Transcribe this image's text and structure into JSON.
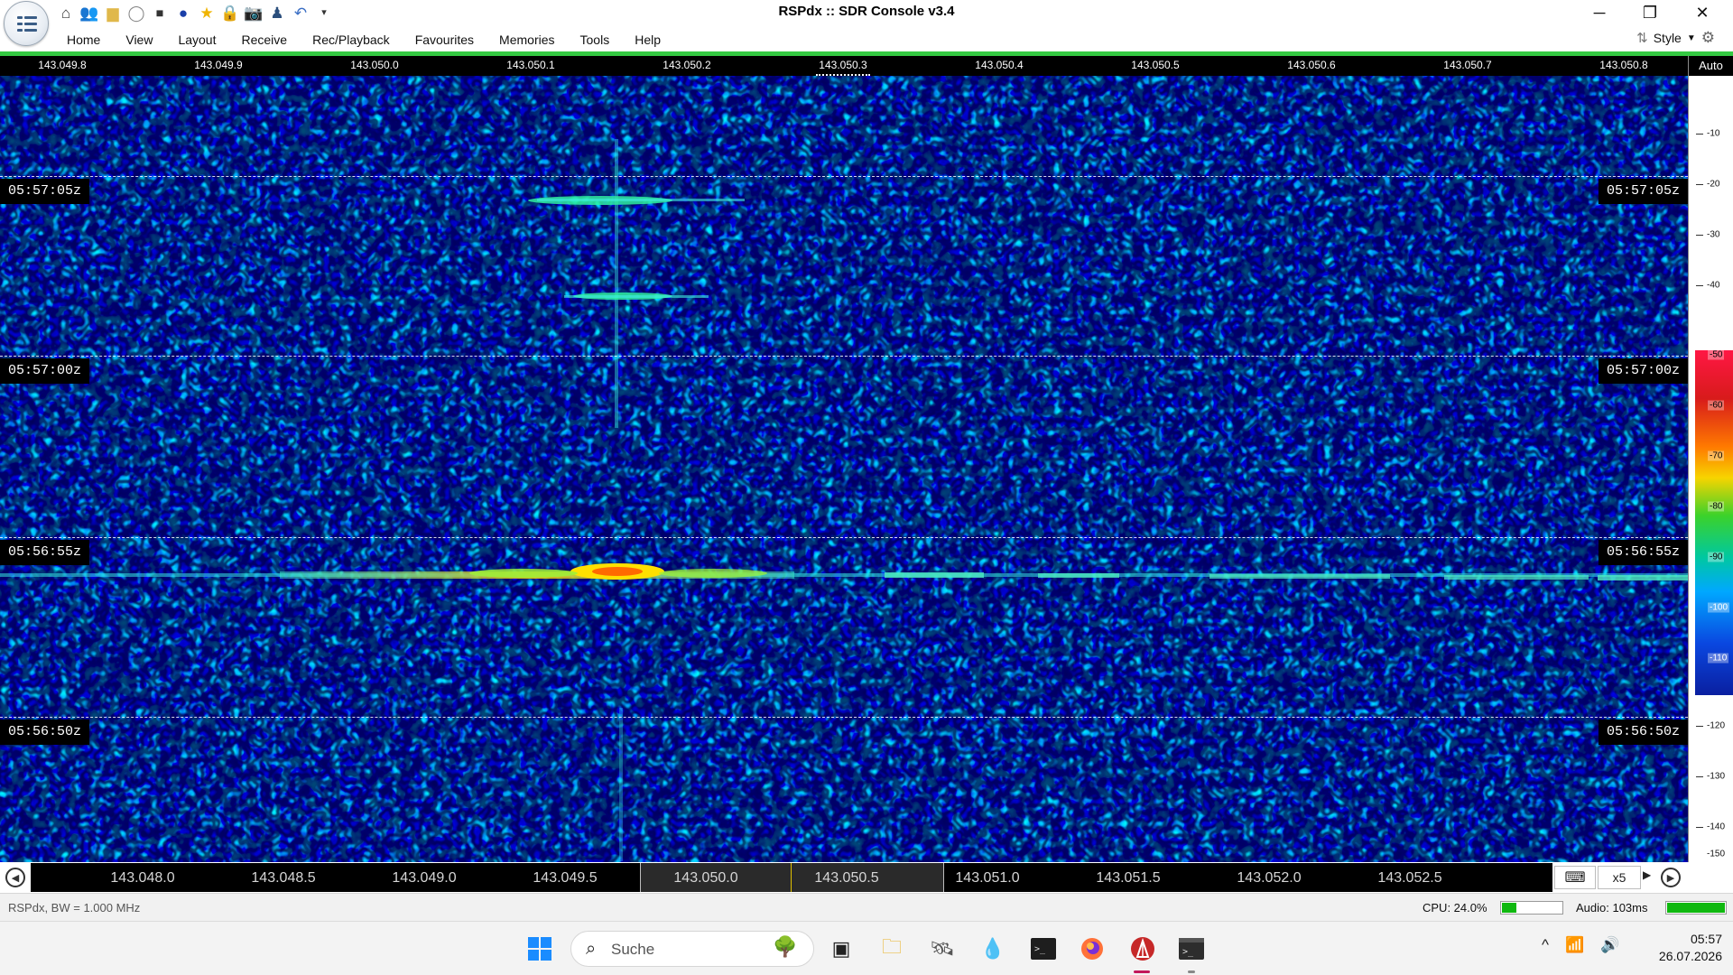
{
  "window": {
    "title": "RSPdx :: SDR Console v3.4",
    "controls": {
      "minimize": "─",
      "restore": "❐",
      "close": "✕"
    }
  },
  "quick_access": [
    "home-icon",
    "users-icon",
    "folder-icon",
    "play-icon",
    "stop-icon",
    "record-icon",
    "star-icon",
    "lock-icon",
    "camera-icon",
    "person-icon",
    "undo-icon",
    "dropdown-icon"
  ],
  "ribbon": {
    "tabs": [
      "Home",
      "View",
      "Layout",
      "Receive",
      "Rec/Playback",
      "Favourites",
      "Memories",
      "Tools",
      "Help"
    ],
    "style_label": "Style"
  },
  "top_scale": {
    "labels": [
      "143.049.8",
      "143.049.9",
      "143.050.0",
      "143.050.1",
      "143.050.2",
      "143.050.3",
      "143.050.4",
      "143.050.5",
      "143.050.6",
      "143.050.7",
      "143.050.8"
    ]
  },
  "level_scale": {
    "auto_label": "Auto",
    "labels": [
      "-10",
      "-20",
      "-30",
      "-40",
      "-50",
      "-60",
      "-70",
      "-80",
      "-90",
      "-100",
      "-110",
      "-120",
      "-130",
      "-140",
      "-150"
    ]
  },
  "waterfall": {
    "timestamps": [
      "05:57:05z",
      "05:57:00z",
      "05:56:55z",
      "05:56:50z"
    ],
    "colors": {
      "noise_base": "#0a2fc8",
      "signal_peak": "#ffe000",
      "signal_mid": "#35ffb0"
    }
  },
  "bottom_scale": {
    "labels": [
      "143.048.0",
      "143.048.5",
      "143.049.0",
      "143.049.5",
      "143.050.0",
      "143.050.5",
      "143.051.0",
      "143.051.5",
      "143.052.0",
      "143.052.5"
    ],
    "zoom": "x5",
    "keyboard_icon": "keyboard-icon"
  },
  "status": {
    "left": "RSPdx, BW = 1.000 MHz",
    "cpu": "CPU: 24.0%",
    "cpu_fraction": 0.24,
    "audio": "Audio: 103ms",
    "audio_fraction": 1.0
  },
  "taskbar": {
    "search_placeholder": "Suche",
    "time": "05:57",
    "date": "26.07.2026",
    "apps": [
      "windows-start-icon",
      "file-explorer-icon",
      "folders-icon",
      "satellite-icon",
      "app-drop-icon",
      "terminal-icon",
      "firefox-icon",
      "sdr-console-icon",
      "terminal-shell-icon"
    ]
  }
}
